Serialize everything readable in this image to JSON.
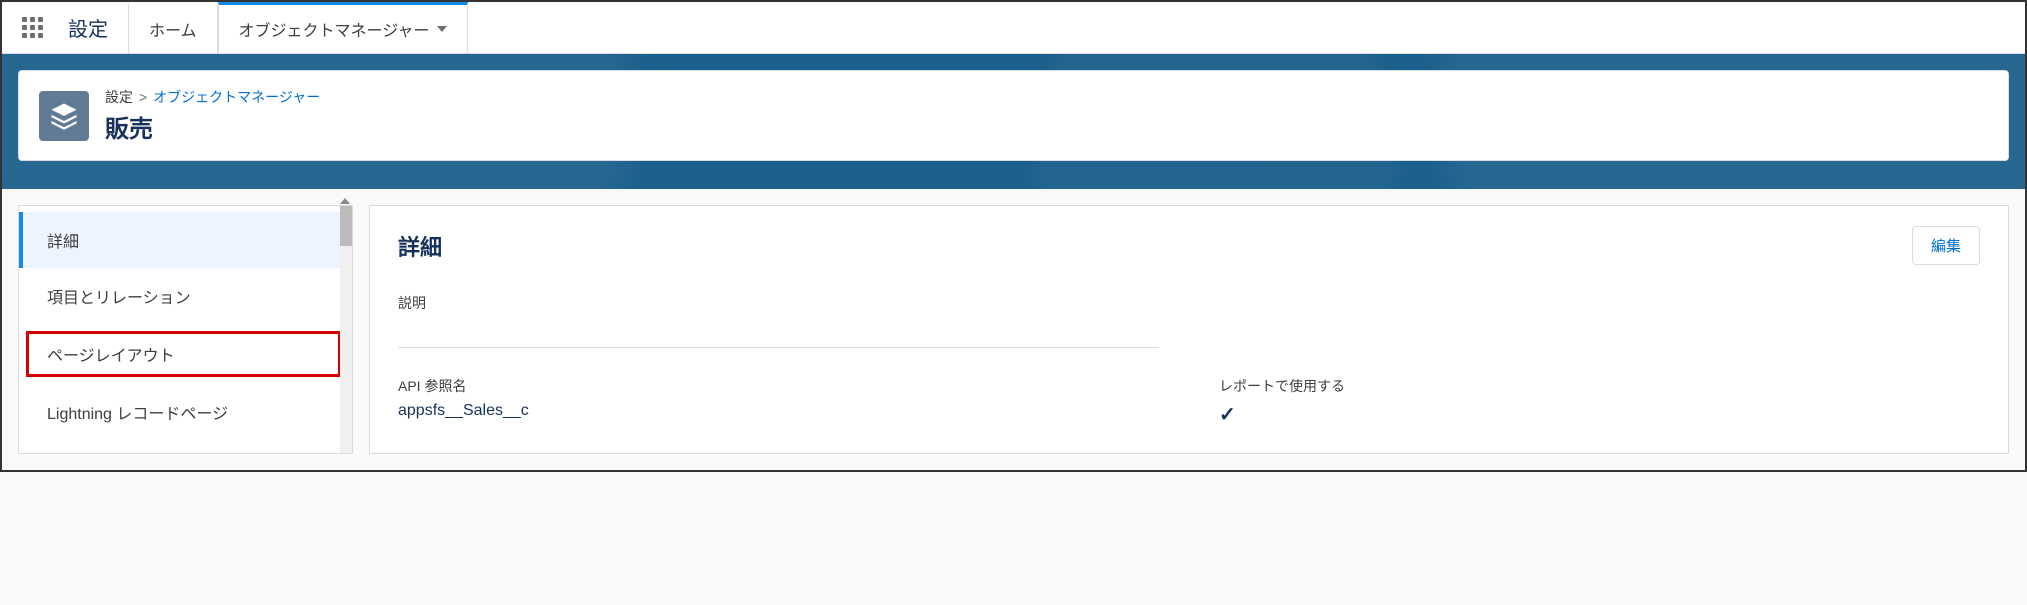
{
  "topbar": {
    "app_title": "設定",
    "tabs": [
      {
        "label": "ホーム",
        "active": false
      },
      {
        "label": "オブジェクトマネージャー",
        "active": true,
        "dropdown": true
      }
    ]
  },
  "breadcrumb": {
    "root": "設定",
    "link": "オブジェクトマネージャー"
  },
  "object": {
    "title": "販売"
  },
  "sidebar": {
    "items": [
      {
        "label": "詳細",
        "selected": true
      },
      {
        "label": "項目とリレーション"
      },
      {
        "label": "ページレイアウト",
        "highlighted": true
      },
      {
        "label": "Lightning レコードページ"
      }
    ]
  },
  "panel": {
    "title": "詳細",
    "edit_button": "編集",
    "fields": {
      "description": {
        "label": "説明",
        "value": ""
      },
      "api_name": {
        "label": "API 参照名",
        "value": "appsfs__Sales__c"
      },
      "use_in_report": {
        "label": "レポートで使用する",
        "checked": true
      }
    }
  }
}
